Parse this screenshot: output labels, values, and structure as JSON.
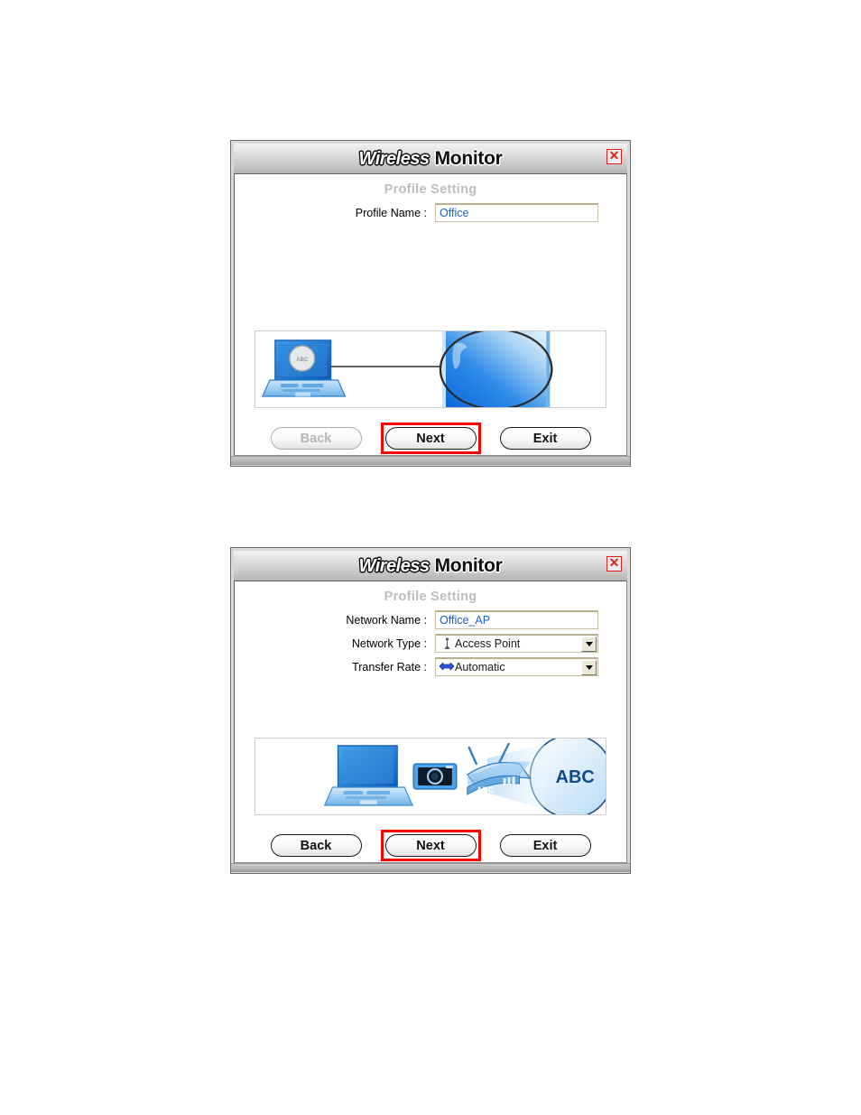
{
  "dialogs": [
    {
      "title_part1": "Wireless",
      "title_part2": "Monitor",
      "close_label": "✕",
      "section_title": "Profile Setting",
      "fields": [
        {
          "label": "Profile Name :",
          "value": "Office",
          "type": "text"
        }
      ],
      "illustration": {
        "name": "laptop-connected-to-network-circle",
        "badge_text": "ABC"
      },
      "buttons": [
        {
          "name": "back-button",
          "label": "Back",
          "disabled": true,
          "highlighted": false
        },
        {
          "name": "next-button",
          "label": "Next",
          "disabled": false,
          "highlighted": true
        },
        {
          "name": "exit-button",
          "label": "Exit",
          "disabled": false,
          "highlighted": false
        }
      ]
    },
    {
      "title_part1": "Wireless",
      "title_part2": "Monitor",
      "close_label": "✕",
      "section_title": "Profile Setting",
      "fields": [
        {
          "label": "Network Name :",
          "value": "Office_AP",
          "type": "text"
        },
        {
          "label": "Network Type :",
          "value": "Access Point",
          "type": "combo",
          "icon": "antenna-tower-icon"
        },
        {
          "label": "Transfer Rate :",
          "value": "Automatic",
          "type": "combo",
          "icon": "double-arrow-icon"
        }
      ],
      "illustration": {
        "name": "laptop-camera-router-network-ssid",
        "router_text": "ABC",
        "ssid_text": "ABC"
      },
      "buttons": [
        {
          "name": "back-button",
          "label": "Back",
          "disabled": false,
          "highlighted": false
        },
        {
          "name": "next-button",
          "label": "Next",
          "disabled": false,
          "highlighted": true
        },
        {
          "name": "exit-button",
          "label": "Exit",
          "disabled": false,
          "highlighted": false
        }
      ]
    }
  ],
  "colors": {
    "accent_blue": "#1a5fd0",
    "highlight_red": "#ff0000",
    "section_gray": "#bdbdbd",
    "field_border": "#c8c0a0"
  }
}
